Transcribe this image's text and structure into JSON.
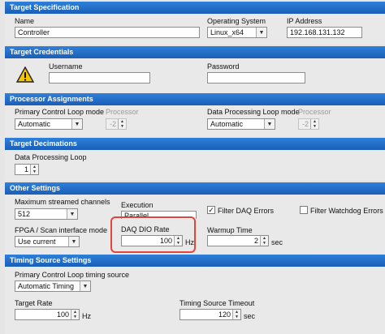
{
  "target_spec": {
    "header": "Target Specification",
    "name_label": "Name",
    "name_value": "Controller",
    "os_label": "Operating System",
    "os_value": "Linux_x64",
    "ip_label": "IP Address",
    "ip_value": "192.168.131.132"
  },
  "credentials": {
    "header": "Target Credentials",
    "username_label": "Username",
    "username_value": "",
    "password_label": "Password",
    "password_value": ""
  },
  "processor": {
    "header": "Processor Assignments",
    "pcl_mode_label": "Primary Control Loop mode",
    "pcl_mode_value": "Automatic",
    "pcl_proc_label": "Processor",
    "pcl_proc_value": "-2",
    "dpl_mode_label": "Data Processing Loop mode",
    "dpl_mode_value": "Automatic",
    "dpl_proc_label": "Processor",
    "dpl_proc_value": "-2"
  },
  "decimations": {
    "header": "Target Decimations",
    "dpl_label": "Data Processing Loop",
    "dpl_value": "1"
  },
  "other": {
    "header": "Other Settings",
    "max_channels_label": "Maximum streamed channels",
    "max_channels_value": "512",
    "execution_label": "Execution",
    "execution_value": "Parallel",
    "filter_daq_label": "Filter DAQ Errors",
    "filter_daq_checked": true,
    "filter_daq_mark": "✓",
    "filter_watchdog_label": "Filter Watchdog Errors",
    "filter_watchdog_checked": false,
    "fpga_label": "FPGA / Scan interface mode",
    "fpga_value": "Use current",
    "daq_rate_label": "DAQ DIO Rate",
    "daq_rate_value": "100",
    "daq_rate_unit": "Hz",
    "warmup_label": "Warmup Time",
    "warmup_value": "2",
    "warmup_unit": "sec"
  },
  "timing": {
    "header": "Timing Source Settings",
    "pcl_timing_label": "Primary Control Loop timing source",
    "pcl_timing_value": "Automatic Timing",
    "target_rate_label": "Target Rate",
    "target_rate_value": "100",
    "target_rate_unit": "Hz",
    "timeout_label": "Timing Source Timeout",
    "timeout_value": "120",
    "timeout_unit": "sec"
  },
  "colors": {
    "header_blue": "#1f6cc8",
    "highlight_red": "#e0463c",
    "warning_yellow": "#f5c400"
  },
  "icons": {
    "dropdown": "chevron-down-icon",
    "spinner": "spinner-arrows-icon",
    "warning": "warning-icon"
  }
}
